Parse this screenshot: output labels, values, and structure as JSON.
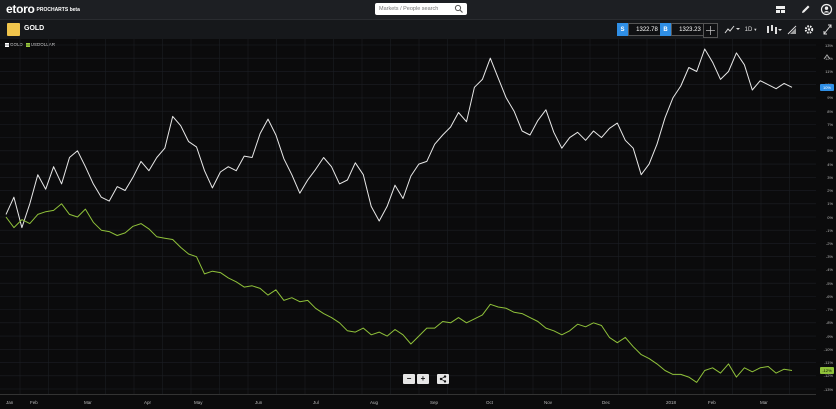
{
  "app": {
    "logo": "etoro",
    "logo_sub": "PROCHARTS beta",
    "search_placeholder": "Markets / People search"
  },
  "instrument": {
    "name": "GOLD",
    "sell_label": "S",
    "sell_price": "1322.78",
    "buy_label": "B",
    "buy_price": "1323.23",
    "timeframe": "1D"
  },
  "legend": [
    {
      "label": "GOLD",
      "color": "#ffffff"
    },
    {
      "label": "USDOLLAR",
      "color": "#9ccc3c"
    }
  ],
  "colors": {
    "gold_line": "#e8e8e8",
    "usd_line": "#8fc13a",
    "accent": "#2f8fe6",
    "grid": "#1c1f24"
  },
  "chart_data": {
    "type": "line",
    "ylabel_format": "percent",
    "ylim": [
      -13,
      13
    ],
    "y_ticks": [
      "13%",
      "12%",
      "11%",
      "10%",
      "9%",
      "8%",
      "7%",
      "6%",
      "5%",
      "4%",
      "3%",
      "2%",
      "1%",
      "0%",
      "-1%",
      "-2%",
      "-3%",
      "-4%",
      "-5%",
      "-6%",
      "-7%",
      "-8%",
      "-9%",
      "-10%",
      "-11%",
      "-12%",
      "-13%"
    ],
    "x_tick_labels": [
      "Jan",
      "Feb",
      "Mar",
      "Apr",
      "May",
      "Jun",
      "Jul",
      "Aug",
      "Sep",
      "Oct",
      "Nov",
      "Dec",
      "2018",
      "Feb",
      "Mar"
    ],
    "series": [
      {
        "name": "GOLD",
        "values": [
          0.2,
          1.5,
          -0.8,
          1.0,
          3.2,
          2.1,
          3.8,
          2.5,
          4.5,
          5.0,
          3.8,
          2.5,
          1.5,
          1.2,
          2.3,
          2.0,
          3.0,
          4.2,
          3.5,
          4.5,
          5.2,
          7.6,
          6.9,
          5.7,
          5.3,
          3.5,
          2.2,
          3.4,
          3.8,
          3.5,
          4.6,
          4.5,
          6.3,
          7.4,
          6.2,
          4.4,
          3.2,
          1.8,
          2.8,
          3.6,
          4.5,
          3.8,
          2.5,
          2.8,
          4.1,
          3.2,
          0.8,
          -0.3,
          0.8,
          2.4,
          1.4,
          3.1,
          4.0,
          4.2,
          5.5,
          6.2,
          6.8,
          7.9,
          7.2,
          9.8,
          10.4,
          12.0,
          10.5,
          9.0,
          8.0,
          6.5,
          6.2,
          7.3,
          8.1,
          6.4,
          5.2,
          6.0,
          6.4,
          5.8,
          6.5,
          6.0,
          6.7,
          7.1,
          5.8,
          5.2,
          3.2,
          4.0,
          5.5,
          7.5,
          9.0,
          9.9,
          11.3,
          11.0,
          12.7,
          11.7,
          10.4,
          11.0,
          12.4,
          11.5,
          9.6,
          10.3,
          10.0,
          9.7,
          10.1,
          9.8
        ],
        "color": "#e8e8e8"
      },
      {
        "name": "USDOLLAR",
        "values": [
          0.0,
          -0.8,
          -0.2,
          -0.5,
          0.2,
          0.4,
          0.5,
          1.0,
          0.2,
          0.0,
          0.6,
          -0.4,
          -1.0,
          -1.1,
          -1.4,
          -1.2,
          -0.7,
          -0.5,
          -0.9,
          -1.5,
          -1.6,
          -1.7,
          -2.3,
          -2.8,
          -3.0,
          -4.3,
          -4.1,
          -4.2,
          -4.6,
          -4.9,
          -5.3,
          -5.2,
          -5.4,
          -5.9,
          -5.5,
          -6.3,
          -6.1,
          -6.4,
          -6.3,
          -6.9,
          -7.3,
          -7.6,
          -8.0,
          -8.6,
          -8.7,
          -8.4,
          -8.9,
          -8.7,
          -9.0,
          -8.5,
          -8.9,
          -9.6,
          -9.0,
          -8.4,
          -8.4,
          -7.9,
          -8.0,
          -7.6,
          -8.0,
          -7.7,
          -7.4,
          -6.6,
          -6.8,
          -6.9,
          -7.2,
          -7.3,
          -7.6,
          -7.9,
          -8.4,
          -8.6,
          -8.9,
          -8.6,
          -8.1,
          -8.3,
          -8.0,
          -8.2,
          -9.1,
          -9.5,
          -9.1,
          -9.8,
          -10.4,
          -10.7,
          -11.1,
          -11.6,
          -11.9,
          -11.9,
          -12.1,
          -12.5,
          -11.6,
          -11.4,
          -11.8,
          -11.1,
          -12.1,
          -11.4,
          -11.7,
          -11.4,
          -11.3,
          -11.8,
          -11.5,
          -11.6
        ],
        "color": "#8fc13a"
      }
    ],
    "last_value_tags": [
      {
        "series": "GOLD",
        "text": "10%"
      },
      {
        "series": "USDOLLAR",
        "text": "-12%"
      }
    ],
    "grid": true
  },
  "controls": {
    "zoom_out": "−",
    "zoom_in": "+"
  }
}
